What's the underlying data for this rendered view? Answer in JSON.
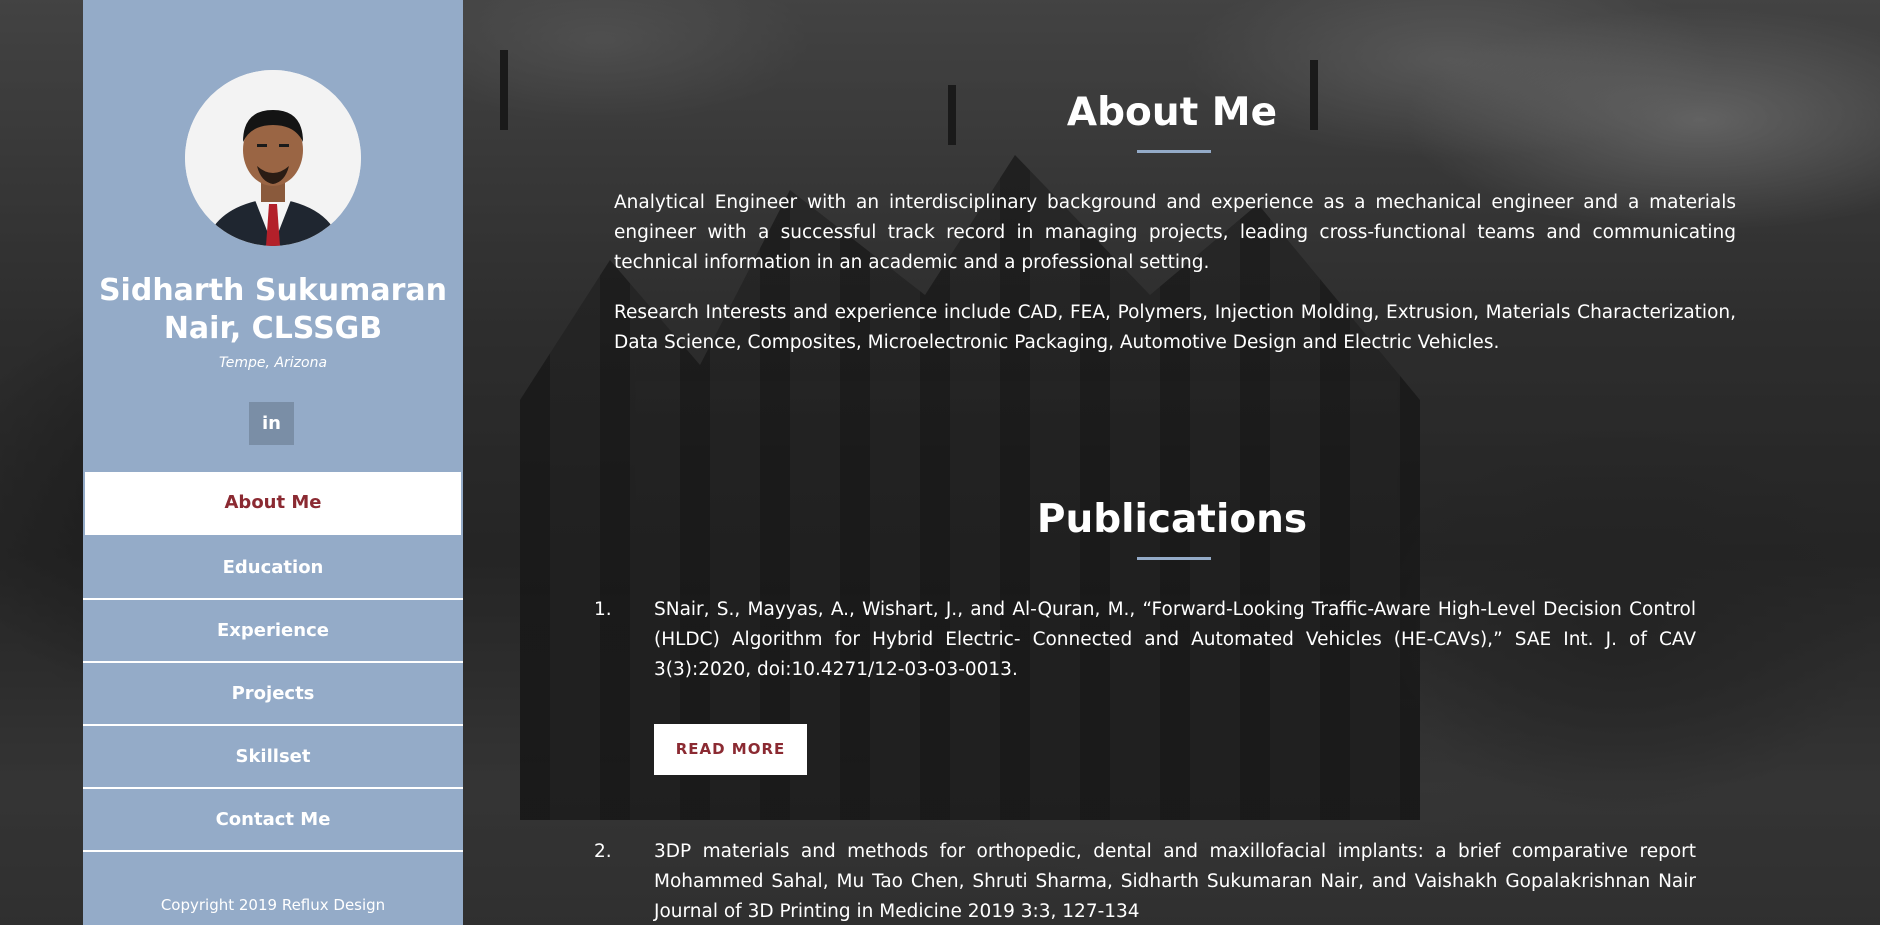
{
  "profile": {
    "name_line1": "Sidharth Sukumaran",
    "name_line2": "Nair, CLSSGB",
    "location": "Tempe, Arizona",
    "linkedin_label": "in"
  },
  "nav": {
    "items": [
      {
        "label": "About Me",
        "active": true
      },
      {
        "label": "Education"
      },
      {
        "label": "Experience"
      },
      {
        "label": "Projects"
      },
      {
        "label": "Skillset"
      },
      {
        "label": "Contact Me"
      }
    ]
  },
  "footer": {
    "copyright": "Copyright 2019 Reflux Design"
  },
  "about": {
    "title": "About Me",
    "paragraphs": [
      "Analytical Engineer with an interdisciplinary background and experience as a mechanical engineer and a materials engineer with a successful track record in managing projects, leading cross-functional teams and communicating technical information in an academic and a professional setting.",
      "Research Interests and experience include CAD, FEA, Polymers, Injection Molding, Extrusion, Materials Characterization, Data Science, Composites, Microelectronic Packaging, Automotive Design and Electric Vehicles."
    ]
  },
  "publications": {
    "title": "Publications",
    "items": [
      {
        "number": "1.",
        "text": "SNair, S., Mayyas, A., Wishart, J., and Al-Quran, M., “Forward-Looking Traffic-Aware High-Level Decision Control (HLDC) Algorithm for Hybrid Electric- Connected and Automated Vehicles (HE-CAVs),” SAE Int. J. of CAV 3(3):2020, doi:10.4271/12-03-03-0013."
      },
      {
        "number": "2.",
        "text": "3DP materials and methods for orthopedic, dental and maxillofacial implants: a brief comparative report Mohammed Sahal, Mu Tao Chen, Shruti Sharma, Sidharth Sukumaran Nair, and Vaishakh Gopalakrishnan Nair Journal of 3D Printing in Medicine 2019 3:3, 127-134"
      }
    ],
    "read_more_label": "READ MORE"
  },
  "colors": {
    "sidebar": "#94abc8",
    "accent": "#8b2a32",
    "linkedin_bg": "#7a8ea6"
  }
}
